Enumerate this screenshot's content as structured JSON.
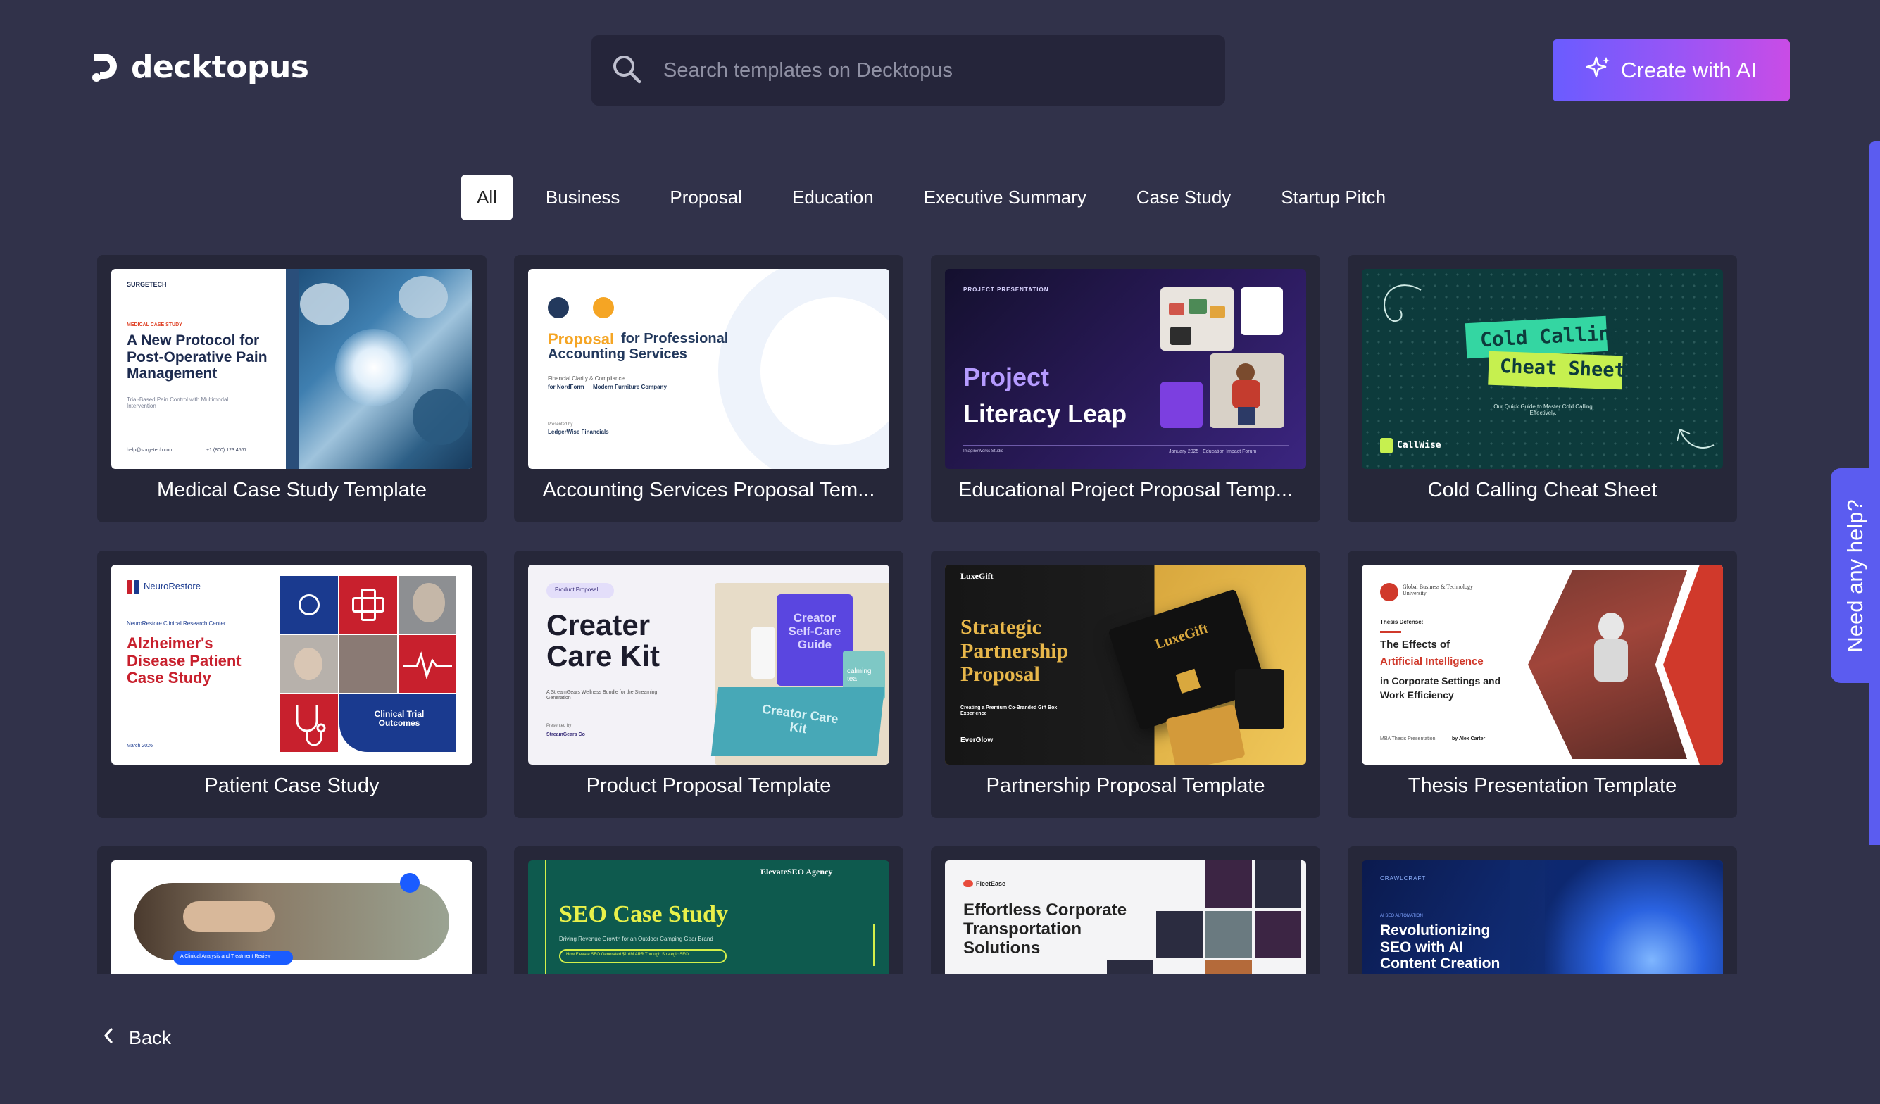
{
  "header": {
    "logo_text": "decktopus",
    "search_placeholder": "Search templates on Decktopus",
    "create_button_label": "Create with AI"
  },
  "tabs": [
    {
      "label": "All",
      "active": true
    },
    {
      "label": "Business",
      "active": false
    },
    {
      "label": "Proposal",
      "active": false
    },
    {
      "label": "Education",
      "active": false
    },
    {
      "label": "Executive Summary",
      "active": false
    },
    {
      "label": "Case Study",
      "active": false
    },
    {
      "label": "Startup Pitch",
      "active": false
    }
  ],
  "cards": [
    {
      "title": "Medical Case Study Template",
      "thumb": {
        "brand": "SURGETECH",
        "kicker": "MEDICAL CASE STUDY",
        "headline": "A New Protocol for Post-Operative Pain Management",
        "sub": "Trial-Based Pain Control with Multimodal Intervention",
        "contact_email": "help@surgetech.com",
        "contact_phone": "+1 (800) 123 4567"
      }
    },
    {
      "title": "Accounting Services Proposal Tem...",
      "thumb": {
        "headline_accent": "Proposal",
        "headline_rest": "for Professional Accounting Services",
        "sub1": "Financial Clarity & Compliance",
        "sub2": "for NordForm — Modern Furniture Company",
        "presented_label": "Presented by",
        "presenter": "LedgerWise Financials"
      }
    },
    {
      "title": "Educational Project Proposal Temp...",
      "thumb": {
        "kicker": "PROJECT PRESENTATION",
        "line1": "Project",
        "line2": "Literacy Leap",
        "footer_left": "ImagineWorks Studio",
        "footer_right": "January 2025 | Education Impact Forum"
      }
    },
    {
      "title": "Cold Calling Cheat Sheet",
      "thumb": {
        "line1": "Cold Calling",
        "line2": "Cheat Sheet",
        "sub": "Our Quick Guide to Master Cold Calling Effectively.",
        "brand": "CallWise"
      }
    },
    {
      "title": "Patient Case Study",
      "thumb": {
        "brand": "NeuroRestore",
        "kicker": "NeuroRestore Clinical Research Center",
        "headline": "Alzheimer's Disease Patient Case Study",
        "badge": "Clinical Trial Outcomes",
        "date": "March 2026"
      }
    },
    {
      "title": "Product Proposal Template",
      "thumb": {
        "pill": "Product Proposal",
        "headline": "Creater Care Kit",
        "sub": "A StreamGears Wellness Bundle for the Streaming Generation",
        "presented_label": "Presented by",
        "presenter": "StreamGears Co",
        "box_text": "Creator Self-Care Guide",
        "box_label": "Creator Care Kit",
        "tea": "calming tea"
      }
    },
    {
      "title": "Partnership Proposal Template",
      "thumb": {
        "brand": "LuxeGift",
        "headline": "Strategic Partnership Proposal",
        "sub": "Creating a Premium Co-Branded Gift Box Experience",
        "partner": "EverGlow",
        "box_brand": "LuxeGift"
      }
    },
    {
      "title": "Thesis Presentation Template",
      "thumb": {
        "brand": "Global Business & Technology University",
        "kicker": "Thesis Defense:",
        "line1": "The Effects of",
        "accent": "Artificial Intelligence",
        "line3": "in Corporate Settings and Work Efficiency",
        "footer_prefix": "MBA Thesis Presentation",
        "footer_by": "by Alex Carter"
      }
    },
    {
      "title": "",
      "thumb": {
        "pill": "A Clinical Analysis and Treatment Review"
      }
    },
    {
      "title": "",
      "thumb": {
        "brand": "ElevateSEO Agency",
        "headline": "SEO Case Study",
        "sub": "Driving Revenue Growth for an Outdoor Camping Gear Brand",
        "pill": "How Elevate SEO Generated $1.6M ARR Through Strategic SEO"
      }
    },
    {
      "title": "",
      "thumb": {
        "brand": "FleetEase",
        "headline": "Effortless Corporate Transportation Solutions"
      }
    },
    {
      "title": "",
      "thumb": {
        "brand": "CRAWLCRAFT",
        "kicker": "AI SEO AUTOMATION",
        "headline": "Revolutionizing SEO with AI Content Creation"
      }
    }
  ],
  "footer": {
    "back_label": "Back"
  },
  "help": {
    "label": "Need any help?"
  },
  "colors": {
    "background": "#31324a",
    "card": "#262739",
    "accent_start": "#6a5cff",
    "accent_end": "#c94ce6",
    "help_tab": "#5b5cf0"
  }
}
